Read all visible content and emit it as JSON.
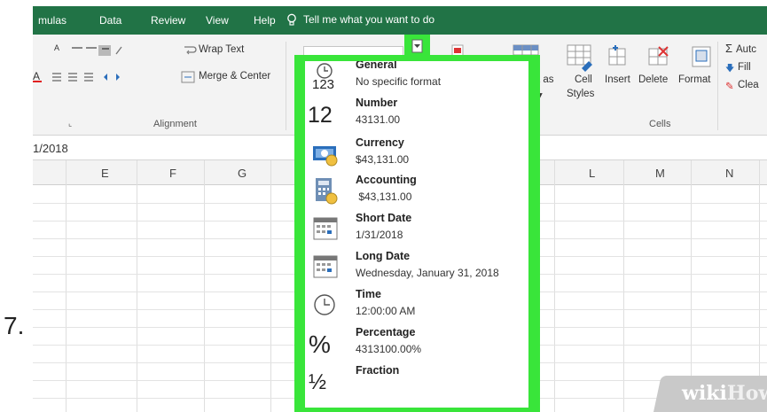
{
  "step": {
    "number": "7."
  },
  "menubar": {
    "tabs": [
      "mulas",
      "Data",
      "Review",
      "View",
      "Help"
    ],
    "tell_me": "Tell me what you want to do",
    "color": "#217346"
  },
  "ribbon": {
    "font_size_label": "A",
    "wrap_text": "Wrap Text",
    "merge_center": "Merge & Center",
    "alignment_group": "Alignment",
    "format_as_table_partial": "t as",
    "cell_styles_label": "Cell",
    "cell_styles_label2": "Styles",
    "insert": "Insert",
    "delete": "Delete",
    "format": "Format",
    "cells_group": "Cells",
    "autosum_partial": "Autc",
    "fill_partial": "Fill",
    "clear_partial": "Clea"
  },
  "formula_bar": {
    "value": "1/2018"
  },
  "columns": [
    "E",
    "F",
    "G",
    "L",
    "M",
    "N"
  ],
  "number_format_dropdown": {
    "highlight_color": "#39e53a",
    "items": [
      {
        "name": "General",
        "sample": "No specific format",
        "icon": "general-123-icon",
        "glyph": "123"
      },
      {
        "name": "Number",
        "sample": "43131.00",
        "icon": "number-12-icon",
        "glyph": "12"
      },
      {
        "name": "Currency",
        "sample": "$43,131.00",
        "icon": "currency-icon"
      },
      {
        "name": "Accounting",
        "sample": " $43,131.00",
        "icon": "accounting-icon"
      },
      {
        "name": "Short Date",
        "sample": "1/31/2018",
        "icon": "calendar-short-icon"
      },
      {
        "name": "Long Date",
        "sample": "Wednesday, January 31, 2018",
        "icon": "calendar-long-icon"
      },
      {
        "name": "Time",
        "sample": "12:00:00 AM",
        "icon": "clock-icon"
      },
      {
        "name": "Percentage",
        "sample": "4313100.00%",
        "icon": "percent-icon",
        "glyph": "%"
      },
      {
        "name": "Fraction",
        "sample": "",
        "icon": "fraction-icon",
        "glyph": "½"
      }
    ]
  },
  "watermark": {
    "wiki": "wiki",
    "how": "How"
  }
}
